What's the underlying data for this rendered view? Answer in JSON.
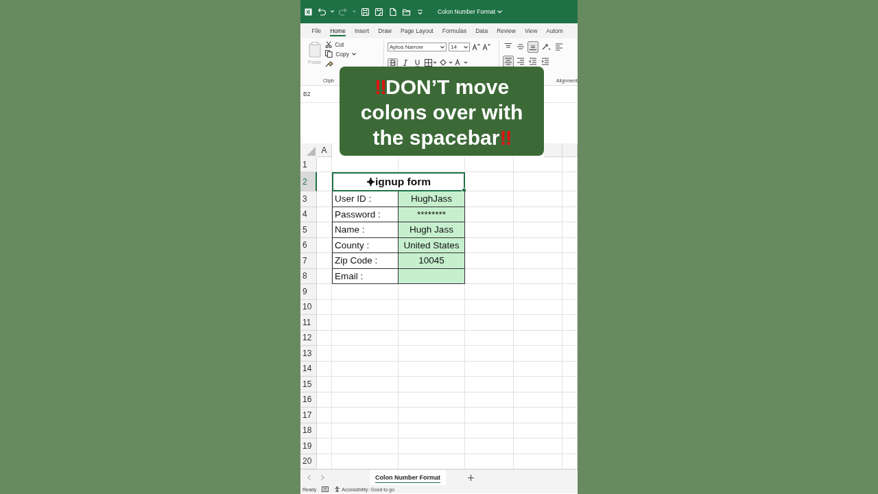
{
  "title_bar": {
    "document_title": "Colon Number Format"
  },
  "quick_access": [
    {
      "kind": "undo",
      "disabled": false
    },
    {
      "kind": "redo",
      "disabled": true
    },
    {
      "kind": "save",
      "disabled": false
    },
    {
      "kind": "save_as",
      "disabled": false
    },
    {
      "kind": "new",
      "disabled": false
    },
    {
      "kind": "open",
      "disabled": false
    },
    {
      "kind": "customize",
      "disabled": false
    }
  ],
  "ribbon_tabs": [
    {
      "label": "File",
      "selected": false
    },
    {
      "label": "Home",
      "selected": true
    },
    {
      "label": "Insert",
      "selected": false
    },
    {
      "label": "Draw",
      "selected": false
    },
    {
      "label": "Page Layout",
      "selected": false
    },
    {
      "label": "Formulas",
      "selected": false
    },
    {
      "label": "Data",
      "selected": false
    },
    {
      "label": "Review",
      "selected": false
    },
    {
      "label": "View",
      "selected": false
    },
    {
      "label": "Autom",
      "selected": false
    }
  ],
  "clipboard": {
    "paste": "Paste",
    "cut": "Cut",
    "copy": "Copy",
    "group_label": "Clipb"
  },
  "font": {
    "name": "Aptos Narrow",
    "size": "14",
    "format_buttons": [
      {
        "kind": "bold",
        "selected": true
      },
      {
        "kind": "italic",
        "selected": false
      },
      {
        "kind": "underline",
        "selected": false
      }
    ]
  },
  "alignment": {
    "group_label": "Alignment",
    "buttons": [
      {
        "kind": "top",
        "selected": false
      },
      {
        "kind": "middle",
        "selected": false
      },
      {
        "kind": "bottom",
        "selected": true
      },
      {
        "kind": "orientation",
        "selected": false
      },
      {
        "kind": "left",
        "selected": false
      },
      {
        "kind": "center",
        "selected": true
      },
      {
        "kind": "right",
        "selected": false
      },
      {
        "kind": "outdent",
        "selected": false
      },
      {
        "kind": "indent",
        "selected": false
      }
    ]
  },
  "name_box": "B2",
  "columns": [
    "A"
  ],
  "rows": [
    {
      "header": "1",
      "selected": false,
      "kind": "blank"
    },
    {
      "header": "2",
      "selected": true,
      "kind": "title",
      "title": "ignup form"
    },
    {
      "header": "3",
      "selected": false,
      "kind": "field",
      "label": "User ID :",
      "value": "HughJass"
    },
    {
      "header": "4",
      "selected": false,
      "kind": "field",
      "label": "Password :",
      "value": "********"
    },
    {
      "header": "5",
      "selected": false,
      "kind": "field",
      "label": "Name :",
      "value": "Hugh Jass"
    },
    {
      "header": "6",
      "selected": false,
      "kind": "field",
      "label": "County :",
      "value": "United States"
    },
    {
      "header": "7",
      "selected": false,
      "kind": "field",
      "label": "Zip Code :",
      "value": "10045"
    },
    {
      "header": "8",
      "selected": false,
      "kind": "field",
      "label": "Email :"
    },
    {
      "header": "9",
      "selected": false,
      "kind": "blank"
    },
    {
      "header": "10",
      "selected": false,
      "kind": "blank"
    },
    {
      "header": "11",
      "selected": false,
      "kind": "blank"
    },
    {
      "header": "12",
      "selected": false,
      "kind": "blank"
    },
    {
      "header": "13",
      "selected": false,
      "kind": "blank"
    },
    {
      "header": "14",
      "selected": false,
      "kind": "blank"
    },
    {
      "header": "15",
      "selected": false,
      "kind": "blank"
    },
    {
      "header": "16",
      "selected": false,
      "kind": "blank"
    },
    {
      "header": "17",
      "selected": false,
      "kind": "blank"
    },
    {
      "header": "18",
      "selected": false,
      "kind": "blank"
    },
    {
      "header": "19",
      "selected": false,
      "kind": "blank"
    },
    {
      "header": "20",
      "selected": false,
      "kind": "blank"
    }
  ],
  "sheet_tabs": [
    {
      "label": "Colon Number Format",
      "selected": true
    }
  ],
  "status_bar": {
    "mode": "Ready",
    "accessibility": "Accessibility: Good to go"
  },
  "caption": {
    "lead_mark": "‼",
    "text": "DON’T move colons over with the spacebar",
    "trail_mark": "‼"
  }
}
